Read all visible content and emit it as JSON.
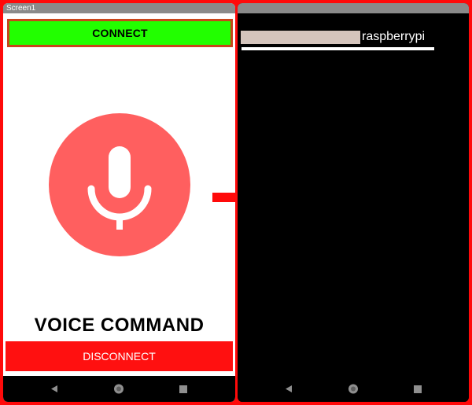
{
  "left_screen": {
    "title": "Screen1",
    "connect_label": "CONNECT",
    "mic_icon": "microphone-icon",
    "voice_label": "VOICE COMMAND",
    "disconnect_label": "DISCONNECT"
  },
  "right_screen": {
    "device_name": "raspberrypi"
  },
  "navbar": {
    "back_icon": "back-triangle-icon",
    "home_icon": "home-circle-icon",
    "recent_icon": "recent-square-icon"
  },
  "colors": {
    "frame": "#ff0a0a",
    "connect_bg": "#22ff00",
    "connect_border": "#c8451b",
    "mic_bg": "#ff5f5f",
    "disconnect_bg": "#ff1010"
  }
}
